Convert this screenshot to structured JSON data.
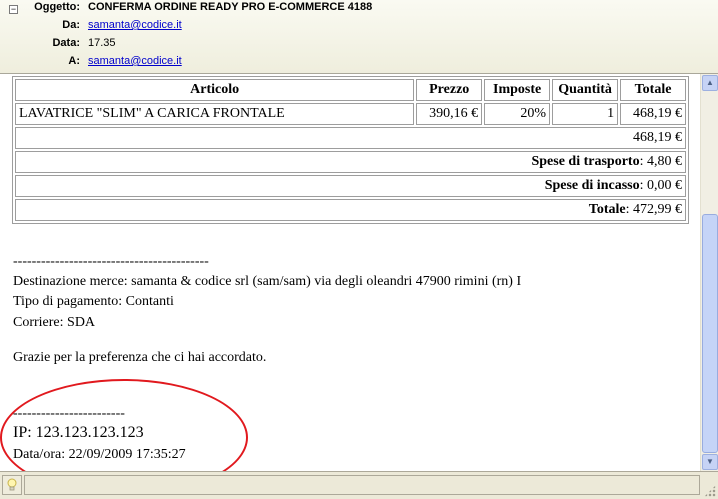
{
  "header": {
    "collapse_symbol": "−",
    "subject_label": "Oggetto:",
    "subject": "CONFERMA ORDINE READY PRO E-COMMERCE 4188",
    "from_label": "Da:",
    "from": "samanta@codice.it",
    "date_label": "Data:",
    "date": "17.35",
    "to_label": "A:",
    "to": "samanta@codice.it"
  },
  "order": {
    "columns": [
      "Articolo",
      "Prezzo",
      "Imposte",
      "Quantità",
      "Totale"
    ],
    "rows": [
      {
        "articolo": "LAVATRICE \"SLIM\" A CARICA FRONTALE",
        "prezzo": "390,16 €",
        "imposte": "20%",
        "quantita": "1",
        "totale": "468,19 €"
      }
    ],
    "subtotal": "468,19 €",
    "shipping_label": "Spese di trasporto",
    "shipping_value": ": 4,80 €",
    "cod_label": "Spese di incasso",
    "cod_value": ": 0,00 €",
    "total_label": "Totale",
    "total_value": ": 472,99 €"
  },
  "message": {
    "separator1": "------------------------------------------",
    "destination": "Destinazione merce: samanta & codice srl (sam/sam) via degli oleandri 47900 rimini (rn) I",
    "payment": "Tipo di pagamento: Contanti",
    "courier": "Corriere: SDA",
    "thanks": "Grazie per la preferenza che ci hai accordato.",
    "separator2": "------------------------",
    "ip": "IP: 123.123.123.123",
    "datetime": "Data/ora: 22/09/2009 17:35:27"
  },
  "scrollbar": {
    "up_glyph": "▲",
    "down_glyph": "▼"
  },
  "status": {
    "icon": "lightbulb-icon"
  },
  "colors": {
    "annotation": "#e1191e",
    "link": "#0000cc"
  }
}
